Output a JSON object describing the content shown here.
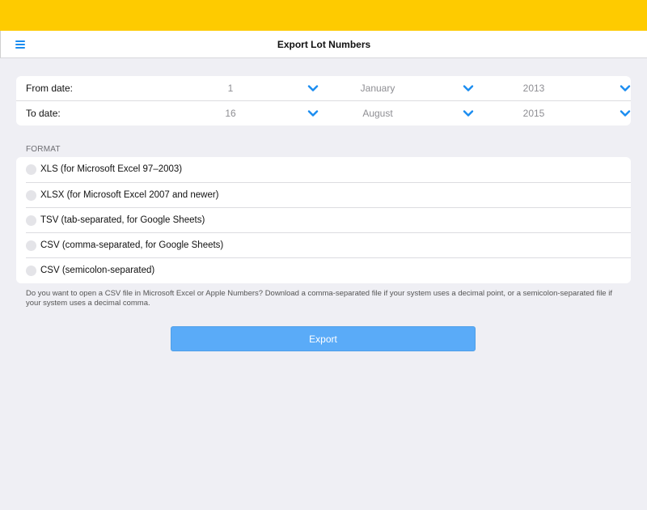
{
  "header": {
    "title": "Export Lot Numbers",
    "menu_icon": "hamburger-menu-icon"
  },
  "colors": {
    "topbar": "#fecb00",
    "accent": "#1a8cf0",
    "button": "#5aabf8",
    "background": "#efeff4"
  },
  "dates": {
    "from": {
      "label": "From date:",
      "day": "1",
      "month": "January",
      "year": "2013"
    },
    "to": {
      "label": "To date:",
      "day": "16",
      "month": "August",
      "year": "2015"
    }
  },
  "format": {
    "section_label": "FORMAT",
    "options": [
      {
        "label": "XLS (for Microsoft Excel 97–2003)",
        "selected": false
      },
      {
        "label": "XLSX (for Microsoft Excel 2007 and newer)",
        "selected": false
      },
      {
        "label": "TSV (tab-separated, for Google Sheets)",
        "selected": false
      },
      {
        "label": "CSV (comma-separated, for Google Sheets)",
        "selected": false
      },
      {
        "label": "CSV (semicolon-separated)",
        "selected": false
      }
    ],
    "note": "Do you want to open a CSV file in Microsoft Excel or Apple Numbers? Download a comma-separated file if your system uses a decimal point, or a semicolon-separated file if your system uses a decimal comma."
  },
  "actions": {
    "export_label": "Export"
  }
}
